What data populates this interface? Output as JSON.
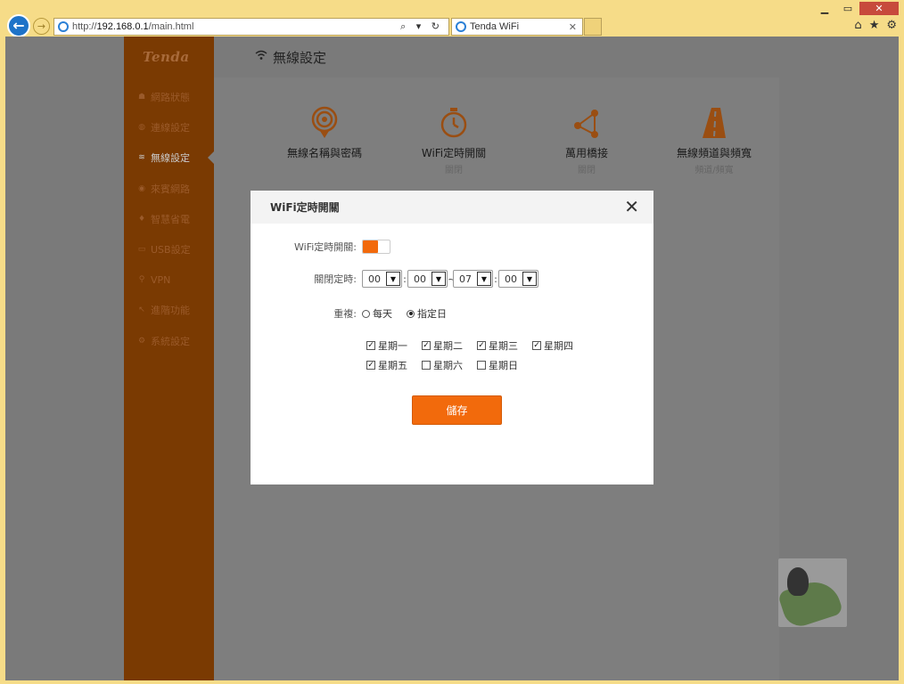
{
  "browser": {
    "url_prefix": "http://",
    "url_host": "192.168.0.1",
    "url_path": "/main.html",
    "address_tools": "⌕ ▾ ↻",
    "tab_title": "Tenda WiFi",
    "tab_close": "✕",
    "win_minimize": "▁",
    "win_maximize": "▭",
    "win_close": "✕",
    "home_glyph": "⌂",
    "star_glyph": "★",
    "gear_glyph": "⚙"
  },
  "sidebar": {
    "logo": "Tenda",
    "items": [
      {
        "label": "網路狀態",
        "icon": "network-status-icon",
        "glyph": "☗"
      },
      {
        "label": "連線設定",
        "icon": "globe-icon",
        "glyph": "◍"
      },
      {
        "label": "無線設定",
        "icon": "wifi-icon",
        "glyph": "≋",
        "active": true
      },
      {
        "label": "來賓網路",
        "icon": "guest-icon",
        "glyph": "◉"
      },
      {
        "label": "智慧省電",
        "icon": "bulb-icon",
        "glyph": "♦"
      },
      {
        "label": "USB設定",
        "icon": "usb-icon",
        "glyph": "▭"
      },
      {
        "label": "VPN",
        "icon": "vpn-icon",
        "glyph": "⚲"
      },
      {
        "label": "進階功能",
        "icon": "wrench-icon",
        "glyph": "↖"
      },
      {
        "label": "系統設定",
        "icon": "settings-icon",
        "glyph": "⚙"
      }
    ]
  },
  "header": {
    "title": "無線設定"
  },
  "features": [
    {
      "title": "無線名稱與密碼",
      "sub": "",
      "icon": "wifi-name-password-icon"
    },
    {
      "title": "WiFi定時開關",
      "sub": "關閉",
      "icon": "wifi-schedule-icon"
    },
    {
      "title": "萬用橋接",
      "sub": "關閉",
      "icon": "universal-bridge-icon"
    },
    {
      "title": "無線頻道與頻寬",
      "sub": "頻道/頻寬",
      "icon": "channel-bandwidth-icon"
    }
  ],
  "modal": {
    "title": "WiFi定時開關",
    "close_glyph": "✕",
    "toggle_label": "WiFi定時開關:",
    "toggle_on": true,
    "schedule_label": "關閉定時:",
    "start_hour": "00",
    "start_min": "00",
    "end_hour": "07",
    "end_min": "00",
    "colon": ":",
    "tilde": "~",
    "repeat_label": "重複:",
    "repeat_options": [
      {
        "label": "每天",
        "checked": false
      },
      {
        "label": "指定日",
        "checked": true
      }
    ],
    "days": [
      {
        "label": "星期一",
        "checked": true
      },
      {
        "label": "星期二",
        "checked": true
      },
      {
        "label": "星期三",
        "checked": true
      },
      {
        "label": "星期四",
        "checked": true
      },
      {
        "label": "星期五",
        "checked": true
      },
      {
        "label": "星期六",
        "checked": false
      },
      {
        "label": "星期日",
        "checked": false
      }
    ],
    "save_label": "儲存"
  },
  "colors": {
    "accent": "#f26a0c",
    "sidebar_bg": "#7a3a02",
    "overlay_bg": "#7e7e7e"
  }
}
